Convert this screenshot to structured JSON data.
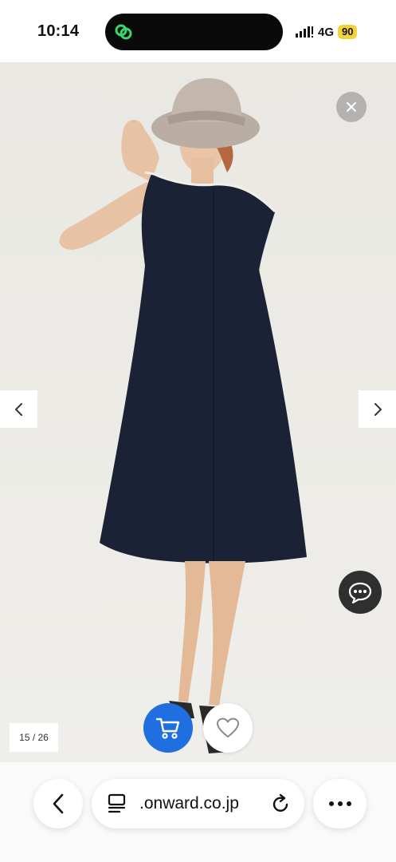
{
  "status_bar": {
    "time": "10:14",
    "network": "4G",
    "battery": "90",
    "island_icon": "link-app-icon",
    "signal_icon": "cellular-signal-icon"
  },
  "viewer": {
    "counter": "15 / 26",
    "close_icon": "close-icon",
    "prev_icon": "chevron-left-icon",
    "next_icon": "chevron-right-icon",
    "chat_icon": "chat-bubble-icon",
    "cart_icon": "cart-icon",
    "favorite_icon": "heart-icon"
  },
  "browser": {
    "url": ".onward.co.jp",
    "back_icon": "back-arrow-icon",
    "reader_icon": "reader-mode-icon",
    "reload_icon": "reload-icon",
    "more_icon": "more-dots-icon"
  },
  "colors": {
    "cart_button": "#1f6fe0",
    "chat_button": "#2f2f2f",
    "battery_badge": "#f3d33a",
    "island_icon": "#39d66a",
    "viewer_background": "#ecebe6",
    "dress": "#1c2236"
  }
}
